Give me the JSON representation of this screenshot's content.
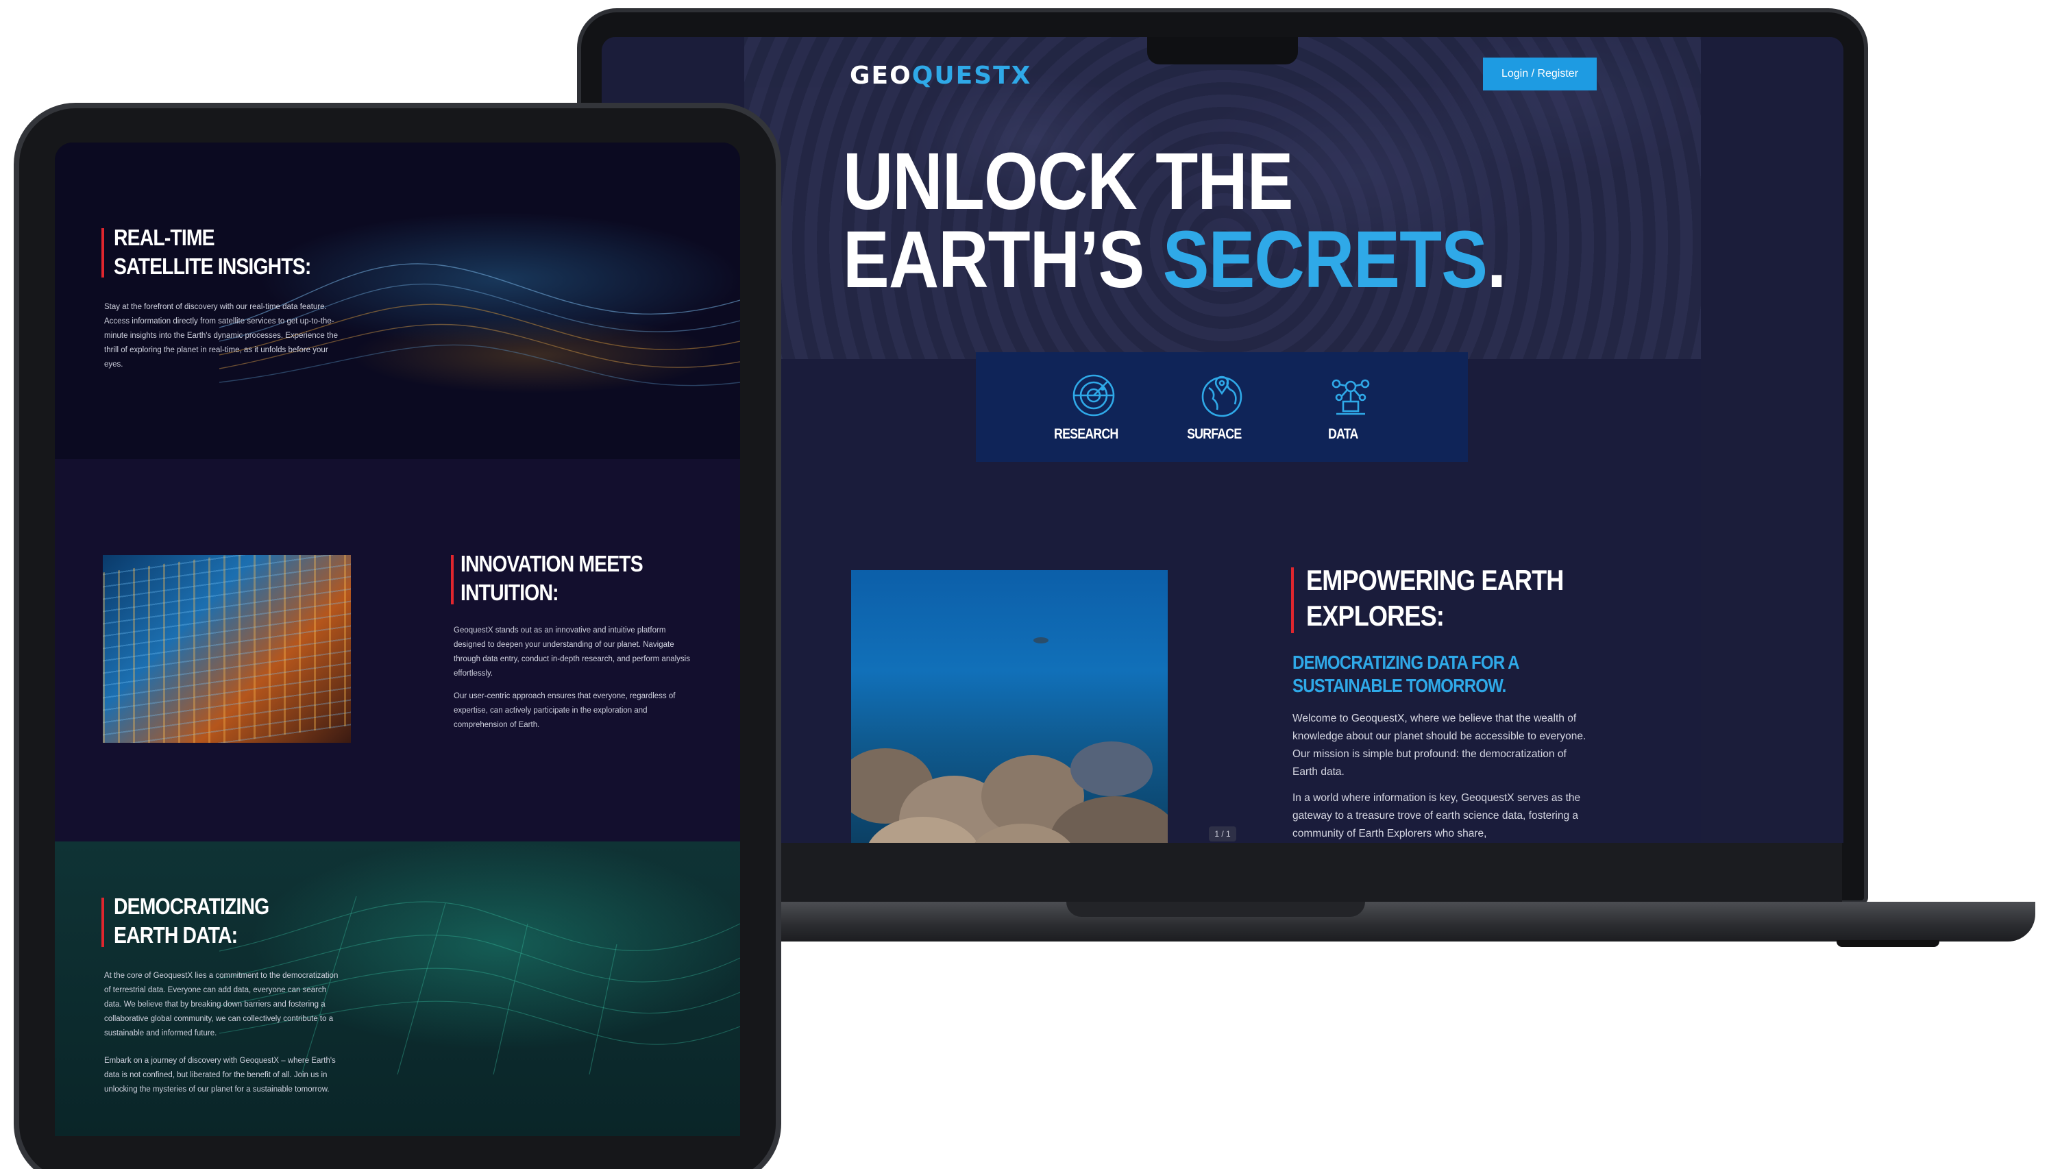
{
  "laptop": {
    "brand": {
      "prefix": "GEO",
      "middle": "QUEST",
      "suffix": "X"
    },
    "login_label": "Login / Register",
    "hero": {
      "line1": "UNLOCK THE",
      "line2_prefix": "EARTH’S ",
      "line2_accent": "SECRETS",
      "line2_suffix": "."
    },
    "features": [
      {
        "label": "RESEARCH",
        "icon": "radar-icon"
      },
      {
        "label": "SURFACE",
        "icon": "globe-pin-icon"
      },
      {
        "label": "DATA",
        "icon": "data-network-icon"
      }
    ],
    "slide_counter": "1 / 1",
    "section": {
      "title_line1": "EMPOWERING EARTH",
      "title_line2": "EXPLORES:",
      "subtitle_line1": "DEMOCRATIZING DATA FOR A",
      "subtitle_line2": "SUSTAINABLE TOMORROW.",
      "paragraph1": "Welcome to GeoquestX, where we believe that the wealth of knowledge about our planet should   be accessible to everyone. Our mission is simple but profound: the democratization of Earth data.",
      "paragraph2": "In a world where information is key, GeoquestX serves as the gateway to a treasure trove of earth science data, fostering a community of Earth Explorers who share,"
    }
  },
  "tablet": {
    "sections": [
      {
        "title_line1": "REAL-TIME",
        "title_line2": "SATELLITE INSIGHTS:",
        "paragraphs": [
          "Stay at the forefront of discovery with our real-time data feature. Access information directly from  satellite services to get up-to-the-minute insights into the Earth's dynamic processes. Experience the thrill of exploring the planet in real-time, as it unfolds before your eyes."
        ]
      },
      {
        "title_line1": "INNOVATION MEETS",
        "title_line2": "INTUITION:",
        "paragraphs": [
          "GeoquestX stands out as an innovative and intuitive platform designed to deepen your    understanding of our planet. Navigate through data entry, conduct in-depth research, and perform    analysis effortlessly.",
          "Our user-centric approach ensures that everyone, regardless of expertise, can    actively participate in the exploration and comprehension of Earth."
        ]
      },
      {
        "title_line1": "DEMOCRATIZING",
        "title_line2": "EARTH DATA:",
        "paragraphs": [
          "At the core of GeoquestX lies a commitment to the democratization of terrestrial data. Everyone can add data, everyone can search data. We believe that by breaking down barriers and fostering a collaborative global community, we can collectively contribute to a sustainable and informed future.",
          "Embark on a journey of discovery with GeoquestX – where Earth's data is not confined, but liberated for the benefit of all. Join us in unlocking the mysteries of our planet for a sustainable tomorrow."
        ]
      }
    ]
  },
  "colors": {
    "accent_blue": "#2fa9e8",
    "accent_red": "#e0262e",
    "panel_navy": "#0f2458",
    "screen_bg": "#1a1c3b"
  }
}
